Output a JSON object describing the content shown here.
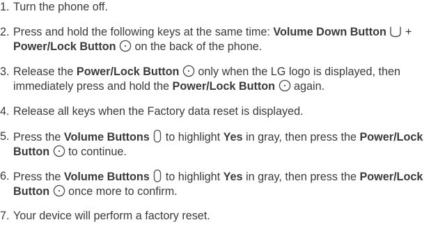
{
  "steps": [
    {
      "num": "1.",
      "text": "Turn the phone off."
    },
    {
      "num": "2.",
      "t1": "Press and hold the following keys at the same time: ",
      "b1": "Volume Down Button",
      "t2": " + ",
      "b2": "Power/Lock Button",
      "t3": " on the back of the phone."
    },
    {
      "num": "3.",
      "t1": "Release the ",
      "b1": "Power/Lock Button",
      "t2": " only when the LG logo is displayed, then immediately press and hold the ",
      "b2": "Power/Lock Button",
      "t3": " again."
    },
    {
      "num": "4.",
      "text": "Release all keys when the Factory data reset is displayed."
    },
    {
      "num": "5.",
      "t1": "Press the ",
      "b1": "Volume Buttons",
      "t2": " to highlight ",
      "b2": "Yes",
      "t3": " in gray, then press the ",
      "b3": "Power/Lock Button",
      "t4": " to continue."
    },
    {
      "num": "6.",
      "t1": "Press the ",
      "b1": "Volume Buttons",
      "t2": " to highlight ",
      "b2": "Yes",
      "t3": " in gray, then press the ",
      "b3": "Power/Lock Button",
      "t4": " once more to confirm."
    },
    {
      "num": "7.",
      "text": "Your device will perform a factory reset."
    }
  ],
  "icons": {
    "volume_down": "volume-down-key-icon",
    "power_lock": "power-lock-key-icon",
    "volume_buttons": "volume-keys-icon"
  },
  "colors": {
    "text": "#3a3a3a",
    "icon_stroke": "#4a4a4a"
  }
}
